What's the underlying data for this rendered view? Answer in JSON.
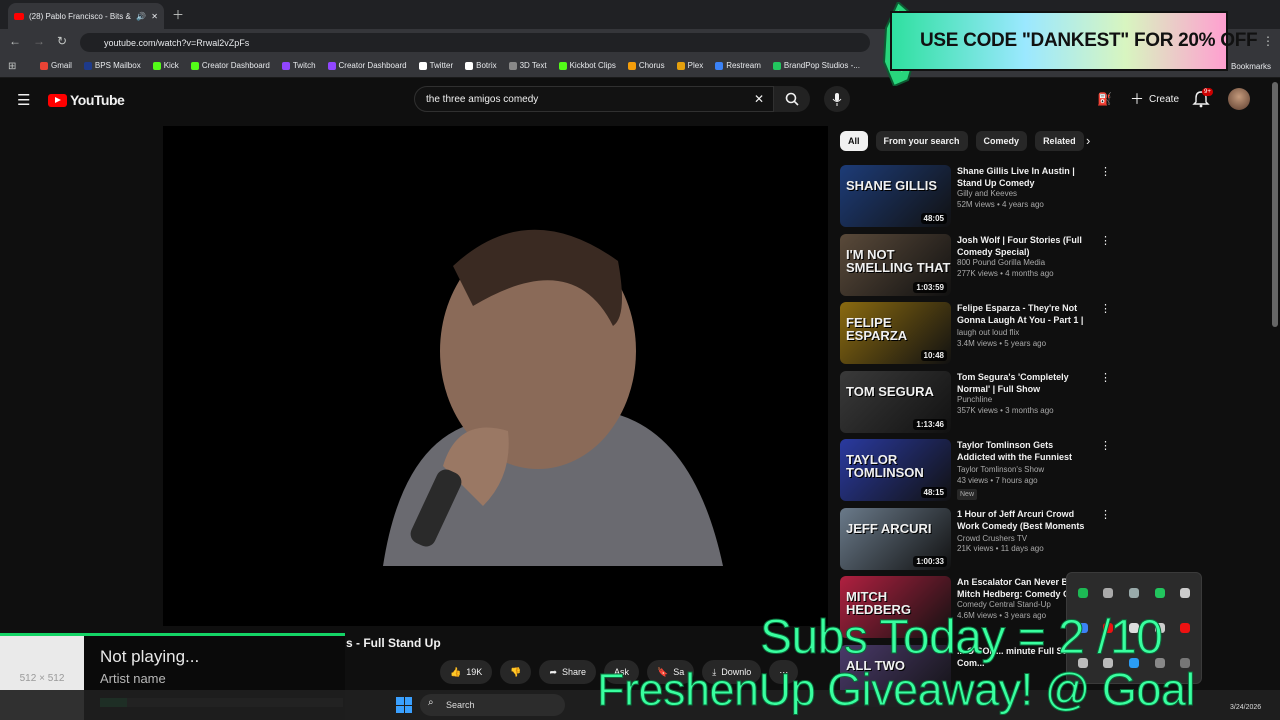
{
  "browser": {
    "tab_title": "(28) Pablo Francisco - Bits &",
    "url": "youtube.com/watch?v=Rrwal2vZpFs",
    "bookmarks": [
      "Gmail",
      "BPS Mailbox",
      "Kick",
      "Creator Dashboard",
      "Twitch",
      "Creator Dashboard",
      "Twitter",
      "Botrix",
      "3D Text",
      "Kickbot Clips",
      "Chorus",
      "Plex",
      "Restream",
      "BrandPop Studios -..."
    ],
    "bookmarks_folder": "Bookmarks"
  },
  "youtube": {
    "logo_text": "YouTube",
    "search_value": "the three amigos comedy",
    "create_label": "Create",
    "notification_badge": "9+"
  },
  "video": {
    "title_visible": "s - Full Stand Up",
    "like_count": "19K",
    "share_label": "Share",
    "ask_label": "Ask",
    "save_label": "Sa",
    "download_label": "Downlo"
  },
  "chips": [
    "All",
    "From your search",
    "Comedy",
    "Related"
  ],
  "recommendations": [
    {
      "title": "Shane Gillis Live In Austin | Stand Up Comedy",
      "channel": "Gilly and Keeves",
      "meta": "52M views • 4 years ago",
      "duration": "48:05",
      "thumb_text": "SHANE GILLIS",
      "color": "#1d3c78"
    },
    {
      "title": "Josh Wolf | Four Stories (Full Comedy Special)",
      "channel": "800 Pound Gorilla Media",
      "meta": "277K views • 4 months ago",
      "duration": "1:03:59",
      "thumb_text": "I'M NOT SMELLING THAT",
      "color": "#5a4a3a"
    },
    {
      "title": "Felipe Esparza - They're Not Gonna Laugh At You - Part 1 | ...",
      "channel": "laugh out loud flix",
      "meta": "3.4M views • 5 years ago",
      "duration": "10:48",
      "thumb_text": "FELIPE ESPARZA",
      "color": "#8a6a10"
    },
    {
      "title": "Tom Segura's 'Completely Normal' | Full Show",
      "channel": "Punchline",
      "meta": "357K views • 3 months ago",
      "duration": "1:13:46",
      "thumb_text": "TOM SEGURA",
      "color": "#3a3a3a"
    },
    {
      "title": "Taylor Tomlinson Gets Addicted with the Funniest Stand-Up ...",
      "channel": "Taylor Tomlinson's Show",
      "meta": "43 views • 7 hours ago",
      "duration": "48:15",
      "thumb_text": "TAYLOR TOMLINSON",
      "color": "#2a3aa0",
      "badge": "New"
    },
    {
      "title": "1 Hour of Jeff Arcuri Crowd Work Comedy (Best Moments ...",
      "channel": "Crowd Crushers TV",
      "meta": "21K views • 11 days ago",
      "duration": "1:00:33",
      "thumb_text": "JEFF ARCURI",
      "color": "#6a7a8a"
    },
    {
      "title": "An Escalator Can Never B... Mitch Hedberg: Comedy C...",
      "channel": "Comedy Central Stand-Up",
      "meta": "4.6M views • 3 years ago",
      "duration": "",
      "thumb_text": "MITCH HEDBERG",
      "color": "#b02040"
    },
    {
      "title": "... O SON... minute Full St... Up Com...",
      "channel": "",
      "meta": "",
      "duration": "",
      "thumb_text": "ALL TWO",
      "color": "#4a3a6a"
    }
  ],
  "promo": {
    "text": "USE CODE \"DANKEST\" FOR 20% OFF"
  },
  "now_playing": {
    "status": "Not playing...",
    "artist": "Artist name",
    "art_label": "512 × 512",
    "progress": 0.11
  },
  "stream_overlay": {
    "subs_text": "Subs Today = 2 /10",
    "giveaway_text": "FreshenUp Giveaway! @ Goal"
  },
  "taskbar": {
    "search_label": "Search",
    "date": "3/24/2026"
  }
}
